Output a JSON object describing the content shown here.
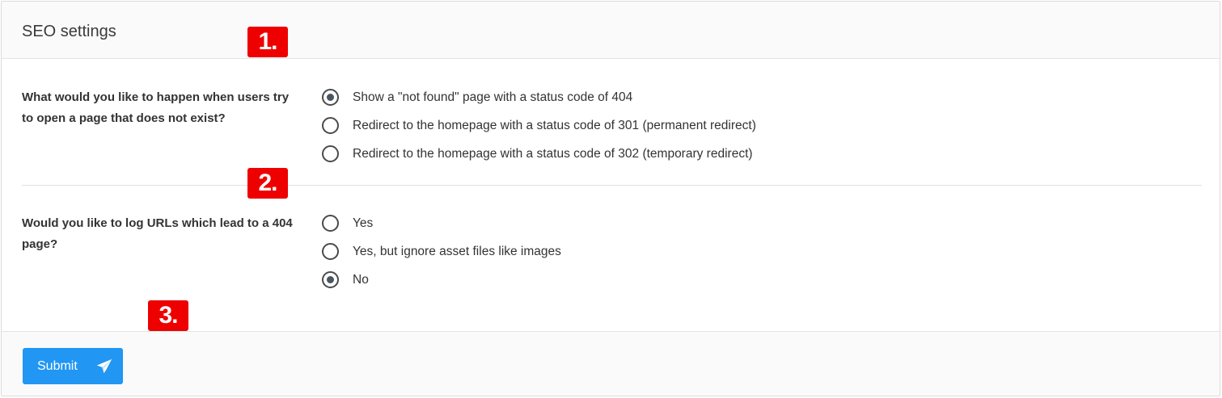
{
  "header": {
    "title": "SEO settings"
  },
  "markers": [
    "1.",
    "2.",
    "3."
  ],
  "section1": {
    "question": "What would you like to happen when users try to open a page that does not exist?",
    "options": [
      {
        "label": "Show a \"not found\" page with a status code of 404",
        "checked": true
      },
      {
        "label": "Redirect to the homepage with a status code of 301 (permanent redirect)",
        "checked": false
      },
      {
        "label": "Redirect to the homepage with a status code of 302 (temporary redirect)",
        "checked": false
      }
    ]
  },
  "section2": {
    "question": "Would you like to log URLs which lead to a 404 page?",
    "options": [
      {
        "label": "Yes",
        "checked": false
      },
      {
        "label": "Yes, but ignore asset files like images",
        "checked": false
      },
      {
        "label": "No",
        "checked": true
      }
    ]
  },
  "footer": {
    "submit_label": "Submit",
    "submit_icon": "paper-plane-icon"
  },
  "colors": {
    "accent": "#2196f3",
    "marker": "#ee0000",
    "radio_dot": "#4a5560"
  }
}
